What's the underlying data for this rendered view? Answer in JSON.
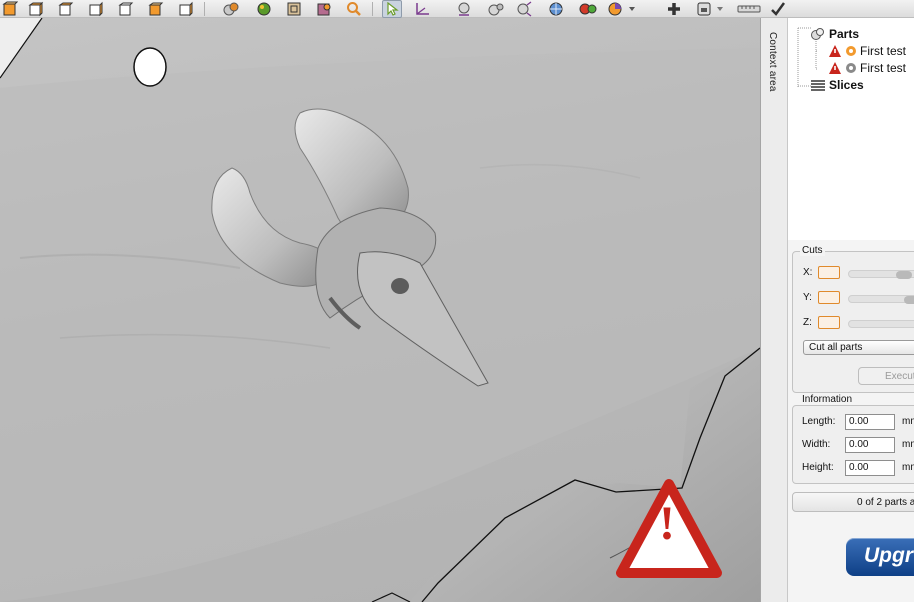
{
  "toolbar": {
    "icons": [
      "view-solid-icon",
      "view-front-icon",
      "view-back-icon",
      "view-left-icon",
      "view-right-icon",
      "view-top-icon",
      "view-bottom-icon",
      "shading-icon",
      "texture-icon",
      "wireframe-icon",
      "render-settings-icon",
      "zoom-icon",
      "select-arrow-icon",
      "measure-icon",
      "sphere-icon",
      "sphere-group-icon",
      "sphere-transform-icon",
      "globe-icon",
      "color-spheres-icon",
      "pie-menu-icon",
      "add-icon",
      "save-copy-icon",
      "ruler-icon",
      "check-icon"
    ]
  },
  "context_area": {
    "label": "Context area"
  },
  "tree": {
    "parts_label": "Parts",
    "items": [
      {
        "label": "First test"
      },
      {
        "label": "First test"
      }
    ],
    "slices_label": "Slices"
  },
  "cuts": {
    "title": "Cuts",
    "axes": [
      {
        "label": "X:"
      },
      {
        "label": "Y:"
      },
      {
        "label": "Z:"
      }
    ],
    "mode": "Cut all parts",
    "execute_label": "Execute"
  },
  "information": {
    "title": "Information",
    "rows": [
      {
        "label": "Length:",
        "value": "0.00",
        "unit": "mm"
      },
      {
        "label": "Width:",
        "value": "0.00",
        "unit": "mm"
      },
      {
        "label": "Height:",
        "value": "0.00",
        "unit": "mm"
      }
    ]
  },
  "status": {
    "text": "0 of 2 parts a"
  },
  "upgrade": {
    "label": "Upgr"
  },
  "warning": {
    "icon": "warning-triangle-icon",
    "glyph": "!",
    "color": "#c8251c"
  },
  "colors": {
    "accent_orange": "#e08a2c",
    "upgrade_blue": "#1a4c93"
  }
}
